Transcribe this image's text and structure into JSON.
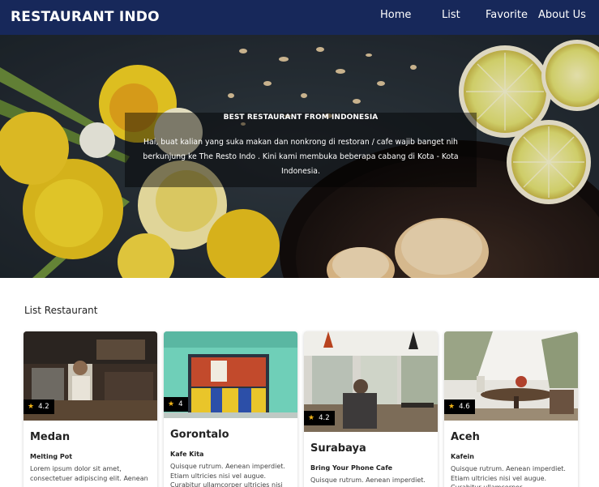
{
  "header": {
    "brand": "RESTAURANT INDO",
    "nav": [
      "Home",
      "List",
      "Favorite",
      "About Us"
    ],
    "background": "#17285a"
  },
  "hero": {
    "title": "BEST RESTAURANT FROM INDONESIA",
    "description": "Hai, buat kalian yang suka makan dan nonkrong di restoran / cafe wajib banget nih berkunjung ke The Resto Indo . Kini kami membuka beberapa cabang di Kota - Kota Indonesia."
  },
  "list": {
    "title": "List Restaurant",
    "cards": [
      {
        "rating": "4.2",
        "city": "Medan",
        "name": "Melting Pot",
        "description": "Lorem ipsum dolor sit amet, consectetuer adipiscing elit. Aenean"
      },
      {
        "rating": "4",
        "city": "Gorontalo",
        "name": "Kafe Kita",
        "description": "Quisque rutrum. Aenean imperdiet. Etiam ultricies nisi vel augue. Curabitur ullamcorper ultricies nisi"
      },
      {
        "rating": "4.2",
        "city": "Surabaya",
        "name": "Bring Your Phone Cafe",
        "description": "Quisque rutrum. Aenean imperdiet."
      },
      {
        "rating": "4.6",
        "city": "Aceh",
        "name": "Kafein",
        "description": "Quisque rutrum. Aenean imperdiet. Etiam ultricies nisi vel augue. Curabitur ullamcorper"
      }
    ]
  },
  "colors": {
    "star": "#f2b618",
    "rating_bg": "#000000"
  }
}
